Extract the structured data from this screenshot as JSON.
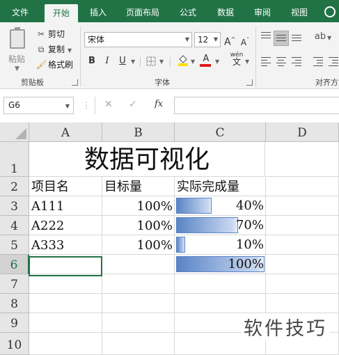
{
  "ribbon_tabs": [
    "文件",
    "开始",
    "插入",
    "页面布局",
    "公式",
    "数据",
    "审阅",
    "视图"
  ],
  "active_tab": "开始",
  "clipboard": {
    "paste": "粘贴",
    "cut": "剪切",
    "copy": "复制",
    "format_painter": "格式刷",
    "group": "剪贴板"
  },
  "font": {
    "name": "宋体",
    "size": "12",
    "grow": "A",
    "shrink": "A",
    "bold": "B",
    "italic": "I",
    "underline": "U",
    "font_color": "A",
    "phonetic": "wén",
    "group": "字体"
  },
  "alignment": {
    "group": "对齐方式"
  },
  "formula_bar": {
    "name_box": "G6",
    "fx": "fx",
    "value": ""
  },
  "columns": [
    "A",
    "B",
    "C",
    "D"
  ],
  "rows": [
    "1",
    "2",
    "3",
    "4",
    "5",
    "6",
    "7",
    "8",
    "9",
    "10"
  ],
  "sheet": {
    "title": "数据可视化",
    "headers": [
      "项目名",
      "目标量",
      "实际完成量"
    ],
    "data": [
      {
        "name": "A111",
        "target": "100%",
        "actual": "40%",
        "fraction": 0.4
      },
      {
        "name": "A222",
        "target": "100%",
        "actual": "70%",
        "fraction": 0.7
      },
      {
        "name": "A333",
        "target": "100%",
        "actual": "10%",
        "fraction": 0.1
      },
      {
        "name": "",
        "target": "",
        "actual": "100%",
        "fraction": 1.0
      }
    ]
  },
  "colors": {
    "ribbon_green": "#217346",
    "data_bar": "#5a84c6"
  },
  "watermark": "软件技巧"
}
